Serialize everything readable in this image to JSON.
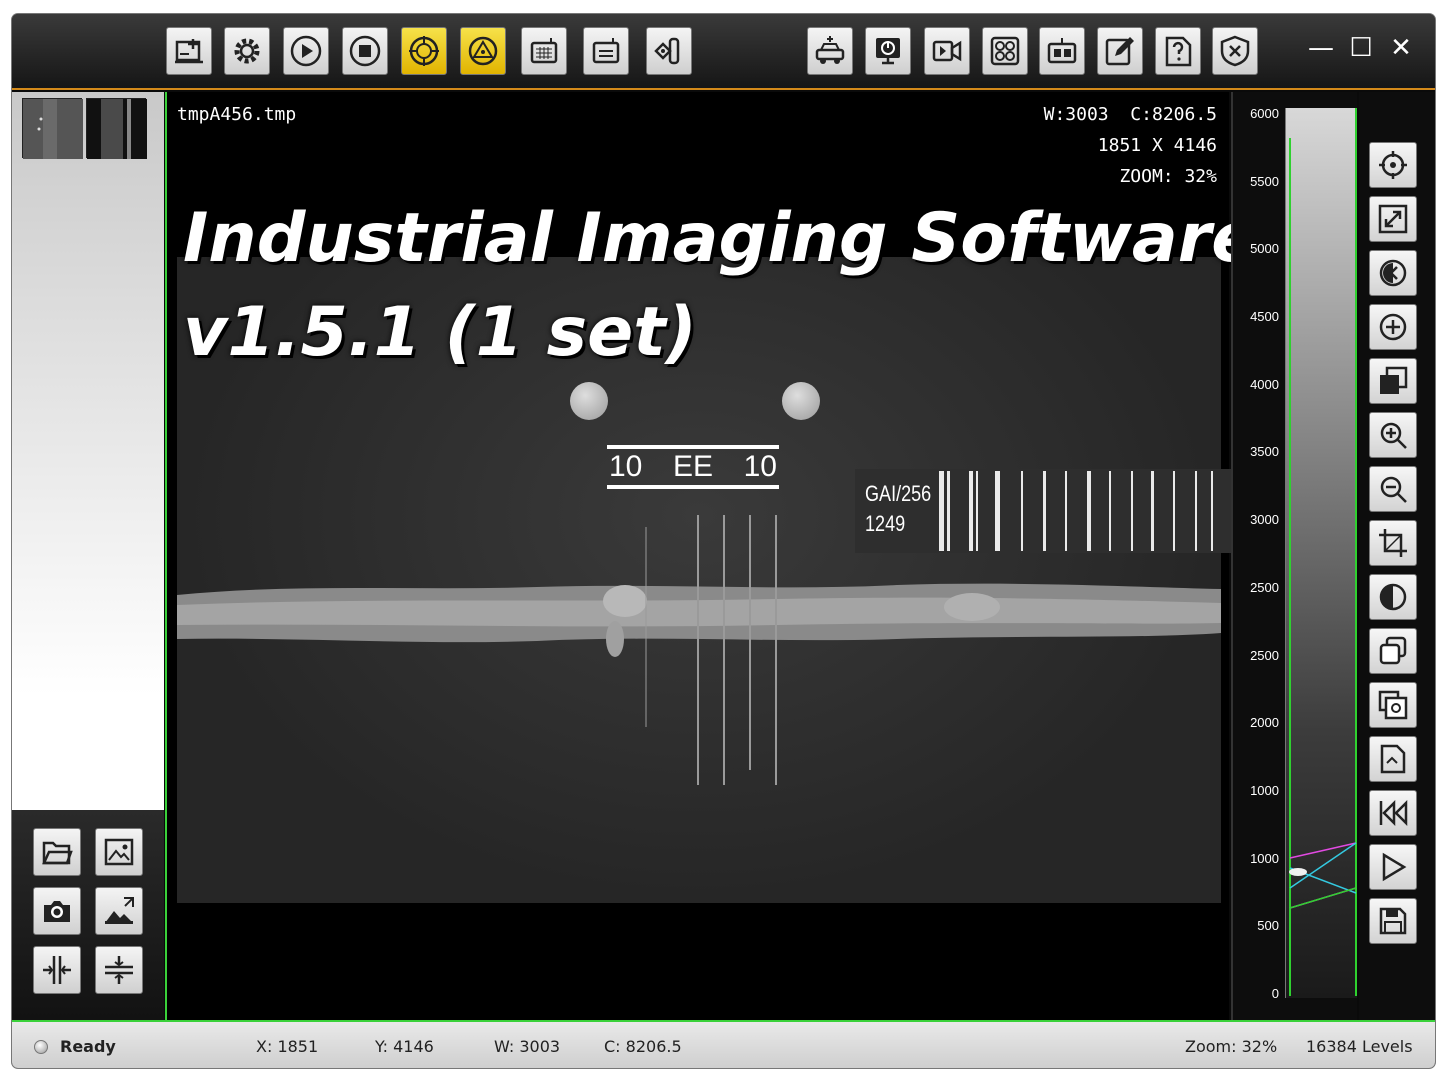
{
  "window": {
    "minimize_glyph": "—",
    "maximize_glyph": "☐",
    "close_glyph": "✕"
  },
  "toolbar": {
    "left_buttons": [
      {
        "name": "acquire-icon"
      },
      {
        "name": "settings-icon"
      },
      {
        "name": "play-icon"
      },
      {
        "name": "stop-icon"
      },
      {
        "name": "target-calibrate-icon"
      },
      {
        "name": "alert-calibrate-icon"
      },
      {
        "name": "detector-grid-icon"
      },
      {
        "name": "detector-panel-icon"
      },
      {
        "name": "xray-tube-icon"
      }
    ],
    "right_buttons": [
      {
        "name": "vehicle-scan-icon"
      },
      {
        "name": "power-monitor-icon"
      },
      {
        "name": "video-icon"
      },
      {
        "name": "multi-view-icon"
      },
      {
        "name": "device-settings-icon"
      },
      {
        "name": "edit-icon"
      },
      {
        "name": "help-icon"
      },
      {
        "name": "exit-icon"
      }
    ],
    "accent_color": "#d48a1a"
  },
  "viewer": {
    "file_name": "tmpA456.tmp",
    "window_center": "W:3003  C:8206.5",
    "dimensions": "1851 X 4146",
    "zoom": "ZOOM: 32%",
    "overlay_title_line1": "Industrial Imaging Software",
    "overlay_title_line2": "v1.5.1 (1 set)",
    "iqi_left": "10",
    "iqi_center": "EE",
    "iqi_right": "10",
    "label_line1": "GAI/256",
    "label_line2": "1249",
    "border_color": "#3ad13a"
  },
  "histogram": {
    "ticks": [
      "6000",
      "5500",
      "5000",
      "4500",
      "4000",
      "3500",
      "3000",
      "2500",
      "2500",
      "2000",
      "1000",
      "1000",
      "500",
      "0"
    ]
  },
  "left_tools": [
    {
      "name": "open-folder-icon"
    },
    {
      "name": "image-icon"
    },
    {
      "name": "camera-icon"
    },
    {
      "name": "image-export-icon"
    },
    {
      "name": "split-vertical-icon"
    },
    {
      "name": "split-horizontal-icon"
    }
  ],
  "right_tools": [
    {
      "name": "crosshair-icon"
    },
    {
      "name": "fit-window-icon"
    },
    {
      "name": "rotate-icon"
    },
    {
      "name": "add-icon"
    },
    {
      "name": "layers-icon"
    },
    {
      "name": "zoom-in-icon"
    },
    {
      "name": "zoom-out-icon"
    },
    {
      "name": "crop-icon"
    },
    {
      "name": "contrast-icon"
    },
    {
      "name": "copy-icon"
    },
    {
      "name": "copy-settings-icon"
    },
    {
      "name": "document-icon"
    },
    {
      "name": "rewind-icon"
    },
    {
      "name": "play-icon"
    },
    {
      "name": "save-icon"
    }
  ],
  "status": {
    "state": "Ready",
    "x": "X: 1851",
    "y": "Y: 4146",
    "w": "W: 3003",
    "c": "C: 8206.5",
    "zoom": "Zoom: 32%",
    "levels": "16384 Levels"
  }
}
